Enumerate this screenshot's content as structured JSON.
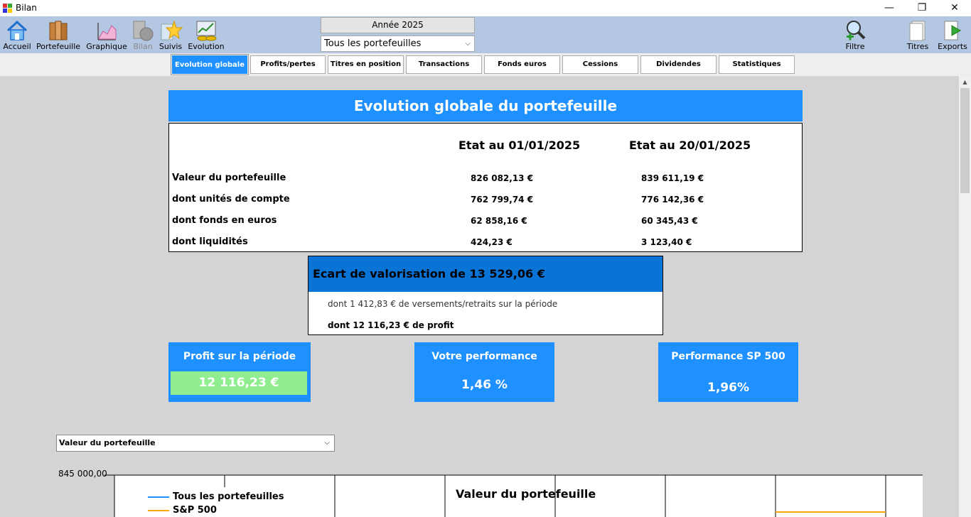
{
  "window": {
    "title": "Bilan",
    "minimize": "—",
    "restore": "❐",
    "close": "✕"
  },
  "toolbar": {
    "items": [
      {
        "label": "Accueil",
        "icon": "home-icon"
      },
      {
        "label": "Portefeuille",
        "icon": "portfolio-icon"
      },
      {
        "label": "Graphique",
        "icon": "chart-icon"
      },
      {
        "label": "Bilan",
        "icon": "balance-icon",
        "disabled": true
      },
      {
        "label": "Suivis",
        "icon": "star-icon"
      },
      {
        "label": "Evolution",
        "icon": "evolution-icon"
      },
      {
        "label": "Filtre",
        "icon": "filter-magnifier-icon"
      },
      {
        "label": "Titres",
        "icon": "titles-icon"
      },
      {
        "label": "Exports",
        "icon": "export-icon"
      }
    ],
    "year": "Année 2025",
    "portfolio_value": "Tous les portefeuilles"
  },
  "tabs": [
    {
      "label": "Evolution globale",
      "active": true
    },
    {
      "label": "Profits/pertes"
    },
    {
      "label": "Titres en position"
    },
    {
      "label": "Transactions"
    },
    {
      "label": "Fonds euros"
    },
    {
      "label": "Cessions"
    },
    {
      "label": "Dividendes"
    },
    {
      "label": "Statistiques"
    }
  ],
  "report": {
    "title": "Evolution globale du portefeuille",
    "col_start": "Etat au 01/01/2025",
    "col_end": "Etat au 20/01/2025",
    "rows": [
      {
        "label": "Valeur du portefeuille",
        "start": "826 082,13 €",
        "end": "839 611,19 €"
      },
      {
        "label": "dont unités de compte",
        "start": "762 799,74 €",
        "end": "776 142,36 €"
      },
      {
        "label": "dont fonds en euros",
        "start": "62 858,16 €",
        "end": "60 345,43 €"
      },
      {
        "label": "dont liquidités",
        "start": "424,23 €",
        "end": "3 123,40 €"
      }
    ]
  },
  "ecart": {
    "title": "Ecart de valorisation de 13 529,06 €",
    "line1": "dont 1 412,83 € de versements/retraits sur la période",
    "line2": "dont 12 116,23 € de profit"
  },
  "kpis": {
    "profit": {
      "title": "Profit sur la période",
      "value": "12 116,23 €"
    },
    "performance": {
      "title": "Votre performance",
      "value": "1,46 %"
    },
    "sp500": {
      "title": "Performance SP 500",
      "value": "1,96%"
    }
  },
  "series_select": "Valeur du portefeuille",
  "chart_data": {
    "type": "line",
    "title": "Valeur du portefeuille",
    "y_tick_labels": [
      "845 000,00"
    ],
    "series": [
      {
        "name": "Tous les portefeuilles",
        "color": "#1e90ff"
      },
      {
        "name": "S&P 500",
        "color": "#ffa500"
      }
    ],
    "grid": true
  },
  "colors": {
    "accent": "#1e90ff",
    "accent_dark": "#0a73d6",
    "profit_green": "#90ee90",
    "toolbar_bg": "#b4c7e2"
  }
}
